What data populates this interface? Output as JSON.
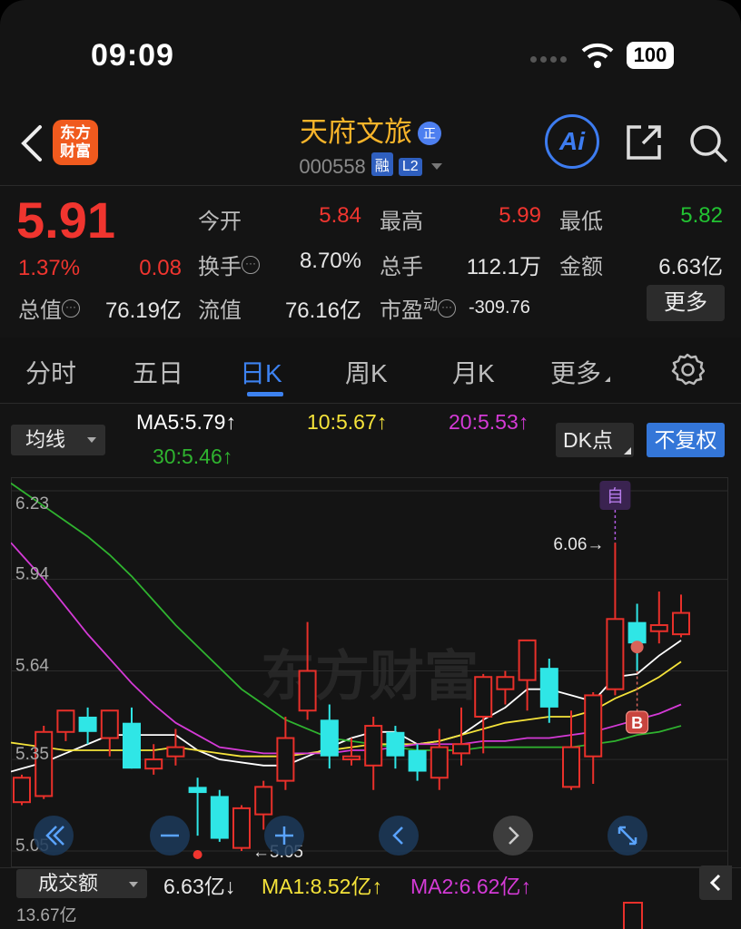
{
  "status_bar": {
    "time": "09:09",
    "battery": "100"
  },
  "header": {
    "logo": "东方财富",
    "stock_name": "天府文旅",
    "badge": "正",
    "code": "000558",
    "tag_margin": "融",
    "tag_level": "L2",
    "ai_label": "Ai"
  },
  "quote": {
    "price": "5.91",
    "change_pct": "1.37%",
    "change": "0.08",
    "open_label": "今开",
    "open": "5.84",
    "high_label": "最高",
    "high": "5.99",
    "low_label": "最低",
    "low": "5.82",
    "turnover_label": "换手",
    "turnover": "8.70%",
    "volume_label": "总手",
    "volume": "112.1万",
    "amount_label": "金额",
    "amount": "6.63亿",
    "mktcap_label": "总值",
    "mktcap": "76.19亿",
    "float_label": "流值",
    "float_cap": "76.16亿",
    "pe_label": "市盈",
    "pe_sup": "动",
    "pe": "-309.76",
    "more_label": "更多"
  },
  "tabs": [
    "分时",
    "五日",
    "日K",
    "周K",
    "月K",
    "更多"
  ],
  "active_tab": "日K",
  "ma_bar": {
    "selector": "均线",
    "ma5": "MA5:5.79↑",
    "ma10": "10:5.67↑",
    "ma20": "20:5.53↑",
    "ma30": "30:5.46↑",
    "dk_label": "DK点",
    "fq_label": "不复权"
  },
  "chart_labels": {
    "watermark": "东方财富",
    "self_marker": "自",
    "b_marker": "B",
    "high_marker": "6.06→",
    "low_marker": "←5.05"
  },
  "chart_data": {
    "type": "candlestick",
    "y_ticks": [
      "6.23",
      "5.94",
      "5.64",
      "5.35",
      "5.05"
    ],
    "ylim": [
      5.05,
      6.23
    ],
    "candles": [
      {
        "o": 5.21,
        "c": 5.29,
        "h": 5.3,
        "l": 5.2
      },
      {
        "o": 5.23,
        "c": 5.44,
        "h": 5.46,
        "l": 5.22
      },
      {
        "o": 5.44,
        "c": 5.51,
        "h": 5.51,
        "l": 5.41
      },
      {
        "o": 5.49,
        "c": 5.44,
        "h": 5.52,
        "l": 5.4
      },
      {
        "o": 5.42,
        "c": 5.51,
        "h": 5.51,
        "l": 5.36
      },
      {
        "o": 5.47,
        "c": 5.32,
        "h": 5.52,
        "l": 5.32
      },
      {
        "o": 5.32,
        "c": 5.35,
        "h": 5.4,
        "l": 5.3
      },
      {
        "o": 5.36,
        "c": 5.39,
        "h": 5.45,
        "l": 5.33
      },
      {
        "o": 5.26,
        "c": 5.24,
        "h": 5.29,
        "l": 5.1
      },
      {
        "o": 5.23,
        "c": 5.09,
        "h": 5.25,
        "l": 5.08
      },
      {
        "o": 5.06,
        "c": 5.19,
        "h": 5.2,
        "l": 5.05
      },
      {
        "o": 5.17,
        "c": 5.26,
        "h": 5.28,
        "l": 5.12
      },
      {
        "o": 5.28,
        "c": 5.42,
        "h": 5.49,
        "l": 5.25
      },
      {
        "o": 5.51,
        "c": 5.64,
        "h": 5.8,
        "l": 5.48
      },
      {
        "o": 5.48,
        "c": 5.36,
        "h": 5.53,
        "l": 5.32
      },
      {
        "o": 5.35,
        "c": 5.36,
        "h": 5.42,
        "l": 5.33
      },
      {
        "o": 5.33,
        "c": 5.46,
        "h": 5.49,
        "l": 5.25
      },
      {
        "o": 5.44,
        "c": 5.36,
        "h": 5.46,
        "l": 5.32
      },
      {
        "o": 5.38,
        "c": 5.31,
        "h": 5.4,
        "l": 5.28
      },
      {
        "o": 5.29,
        "c": 5.39,
        "h": 5.45,
        "l": 5.25
      },
      {
        "o": 5.37,
        "c": 5.4,
        "h": 5.52,
        "l": 5.33
      },
      {
        "o": 5.49,
        "c": 5.62,
        "h": 5.63,
        "l": 5.37
      },
      {
        "o": 5.58,
        "c": 5.62,
        "h": 5.64,
        "l": 5.53
      },
      {
        "o": 5.61,
        "c": 5.74,
        "h": 5.74,
        "l": 5.51
      },
      {
        "o": 5.65,
        "c": 5.52,
        "h": 5.68,
        "l": 5.47
      },
      {
        "o": 5.26,
        "c": 5.39,
        "h": 5.51,
        "l": 5.25
      },
      {
        "o": 5.36,
        "c": 5.56,
        "h": 5.57,
        "l": 5.27
      },
      {
        "o": 5.58,
        "c": 5.81,
        "h": 6.06,
        "l": 5.56
      },
      {
        "o": 5.8,
        "c": 5.73,
        "h": 5.86,
        "l": 5.64
      },
      {
        "o": 5.77,
        "c": 5.79,
        "h": 5.9,
        "l": 5.73
      },
      {
        "o": 5.76,
        "c": 5.83,
        "h": 5.89,
        "l": 5.75
      }
    ],
    "ma": [
      {
        "name": "MA5",
        "color": "#ffffff",
        "values": [
          5.32,
          5.34,
          5.37,
          5.4,
          5.43,
          5.43,
          5.43,
          5.43,
          5.38,
          5.35,
          5.34,
          5.33,
          5.33,
          5.36,
          5.39,
          5.42,
          5.44,
          5.44,
          5.4,
          5.41,
          5.43,
          5.48,
          5.52,
          5.58,
          5.58,
          5.56,
          5.54,
          5.62,
          5.63,
          5.69,
          5.74
        ]
      },
      {
        "name": "MA10",
        "color": "#f5e33a",
        "values": [
          5.4,
          5.39,
          5.38,
          5.38,
          5.38,
          5.38,
          5.38,
          5.39,
          5.38,
          5.37,
          5.36,
          5.36,
          5.36,
          5.37,
          5.38,
          5.39,
          5.4,
          5.4,
          5.4,
          5.41,
          5.43,
          5.45,
          5.47,
          5.48,
          5.49,
          5.49,
          5.51,
          5.55,
          5.58,
          5.62,
          5.67
        ]
      },
      {
        "name": "MA20",
        "color": "#d43ad6",
        "values": [
          6.02,
          5.94,
          5.85,
          5.76,
          5.68,
          5.6,
          5.53,
          5.47,
          5.43,
          5.39,
          5.38,
          5.37,
          5.37,
          5.37,
          5.37,
          5.38,
          5.38,
          5.39,
          5.4,
          5.4,
          5.4,
          5.41,
          5.41,
          5.42,
          5.42,
          5.43,
          5.44,
          5.46,
          5.48,
          5.5,
          5.53
        ]
      },
      {
        "name": "MA30",
        "color": "#2fb32f",
        "values": [
          6.23,
          6.18,
          6.13,
          6.08,
          6.02,
          5.95,
          5.87,
          5.79,
          5.72,
          5.65,
          5.58,
          5.53,
          5.48,
          5.45,
          5.42,
          5.41,
          5.4,
          5.39,
          5.38,
          5.38,
          5.38,
          5.39,
          5.39,
          5.39,
          5.39,
          5.39,
          5.4,
          5.41,
          5.43,
          5.44,
          5.46
        ]
      }
    ]
  },
  "volume": {
    "selector": "成交额",
    "value": "6.63亿↓",
    "ma1": "MA1:8.52亿↑",
    "ma2": "MA2:6.62亿↑",
    "max_label": "13.67亿"
  },
  "colors": {
    "up": "#e8302a",
    "down": "#2fe6e6",
    "accent": "#3d82f0"
  }
}
